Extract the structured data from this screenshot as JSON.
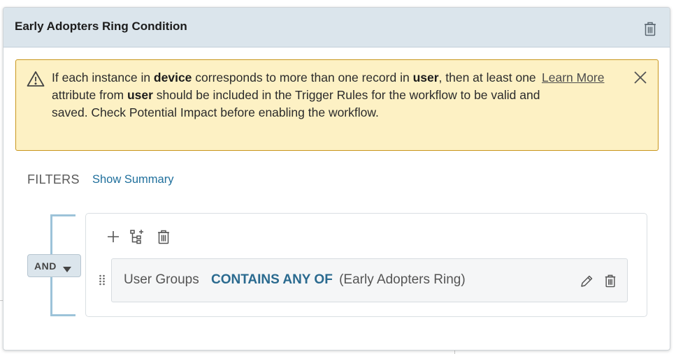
{
  "card": {
    "title": "Early Adopters Ring Condition",
    "delete_icon": "trash-icon"
  },
  "alert": {
    "icon": "warning-triangle-icon",
    "parts": [
      "If each instance in ",
      "device",
      " corresponds to more than one record in ",
      "user",
      ", then at least one attribute from ",
      "user",
      " should be included in the Trigger Rules for the workflow to be valid and saved. Check Potential Impact before enabling the workflow."
    ],
    "link_label": "Learn More",
    "close_icon": "close-icon",
    "colors": {
      "background": "#fdf1c4",
      "border": "#c9961c"
    }
  },
  "filters": {
    "label": "FILTERS",
    "show_summary": "Show Summary",
    "operator": "AND",
    "toolbar": [
      "plus-icon",
      "add-subgroup-icon",
      "trash-icon"
    ],
    "rule": {
      "field": "User Groups",
      "operator": "CONTAINS ANY OF",
      "value": "(Early Adopters Ring)",
      "edit_icon": "pencil-icon",
      "delete_icon": "trash-icon"
    }
  },
  "colors": {
    "header_bg": "#dbe5ec",
    "link": "#1f6f9c",
    "operator_text": "#2a6a8f",
    "bracket": "#9cc3d9"
  }
}
